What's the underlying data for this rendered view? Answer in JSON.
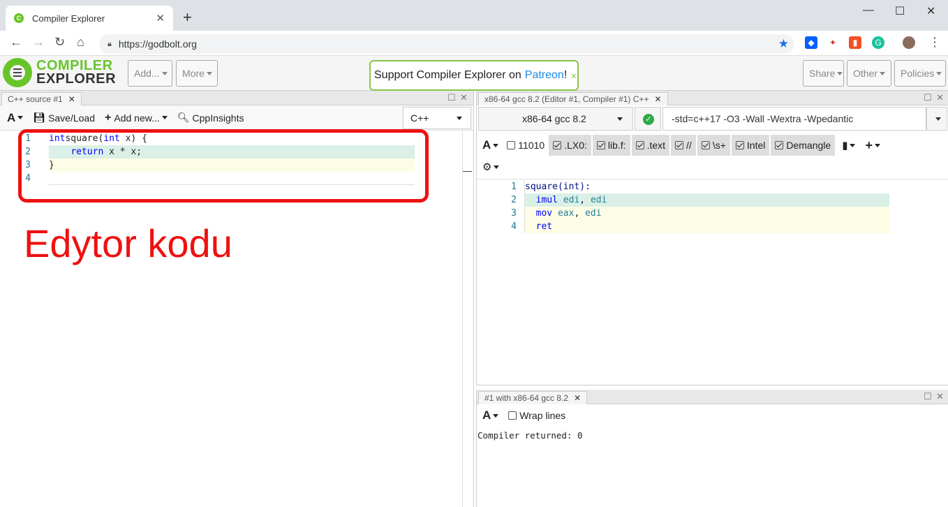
{
  "browser": {
    "tab_title": "Compiler Explorer",
    "url": "https://godbolt.org"
  },
  "header": {
    "logo_line1": "COMPILER",
    "logo_line2": "EXPLORER",
    "add_label": "Add...",
    "more_label": "More",
    "patreon_text": "Support Compiler Explorer on",
    "patreon_link": "Patreon",
    "patreon_suffix": "!",
    "patreon_close": "×",
    "share_label": "Share",
    "other_label": "Other",
    "policies_label": "Policies"
  },
  "editor": {
    "tab_title": "C++ source #1",
    "font_btn": "A",
    "save_load": "Save/Load",
    "add_new": "Add new...",
    "cppinsights": "CppInsights",
    "language": "C++",
    "lines": [
      {
        "num": "1",
        "parts": [
          [
            "kw",
            "int"
          ],
          [
            "",
            "square("
          ],
          [
            "kw",
            "int"
          ],
          [
            "",
            " x) {"
          ]
        ]
      },
      {
        "num": "2",
        "parts": [
          [
            "",
            "    "
          ],
          [
            "kw",
            "return"
          ],
          [
            "",
            " x * x;"
          ]
        ]
      },
      {
        "num": "3",
        "parts": [
          [
            "",
            "}"
          ]
        ]
      },
      {
        "num": "4",
        "parts": [
          [
            "",
            ""
          ]
        ]
      }
    ]
  },
  "compiler": {
    "tab_title": "x86-64 gcc 8.2 (Editor #1, Compiler #1) C++",
    "compiler_name": "x86-64 gcc 8.2",
    "options": "-std=c++17 -O3 -Wall -Wextra -Wpedantic",
    "font_btn": "A",
    "filters": [
      {
        "label": "11010",
        "checked": false
      },
      {
        "label": ".LX0:",
        "checked": true
      },
      {
        "label": "lib.f:",
        "checked": true
      },
      {
        "label": ".text",
        "checked": true
      },
      {
        "label": "//",
        "checked": true
      },
      {
        "label": "\\s+",
        "checked": true
      },
      {
        "label": "Intel",
        "checked": true
      },
      {
        "label": "Demangle",
        "checked": true
      }
    ],
    "asm": [
      {
        "num": "1",
        "parts": [
          [
            "asm-label",
            "square(int):"
          ]
        ]
      },
      {
        "num": "2",
        "parts": [
          [
            "",
            "  "
          ],
          [
            "asm-kw",
            "imul"
          ],
          [
            "",
            " "
          ],
          [
            "asm-reg",
            "edi"
          ],
          [
            "",
            ", "
          ],
          [
            "asm-reg",
            "edi"
          ]
        ]
      },
      {
        "num": "3",
        "parts": [
          [
            "",
            "  "
          ],
          [
            "asm-kw",
            "mov"
          ],
          [
            "",
            " "
          ],
          [
            "asm-reg",
            "eax"
          ],
          [
            "",
            ", "
          ],
          [
            "asm-reg",
            "edi"
          ]
        ]
      },
      {
        "num": "4",
        "parts": [
          [
            "",
            "  "
          ],
          [
            "asm-kw",
            "ret"
          ]
        ]
      }
    ]
  },
  "output": {
    "tab_title": "#1 with x86-64 gcc 8.2",
    "font_btn": "A",
    "wrap_lines": "Wrap lines",
    "result": "Compiler returned: 0"
  },
  "annotation": {
    "label": "Edytor kodu"
  }
}
